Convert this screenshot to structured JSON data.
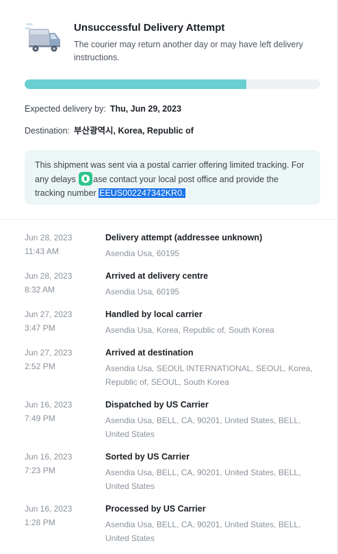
{
  "header": {
    "title": "Unsuccessful Delivery Attempt",
    "subtitle": "The courier may return another day or may have left delivery instructions.",
    "icon": "delivery-truck-icon"
  },
  "progress": {
    "percent": 75,
    "color": "#69cfd0"
  },
  "expected": {
    "label": "Expected delivery by:",
    "value": "Thu, Jun 29, 2023"
  },
  "destination": {
    "label": "Destination:",
    "value_korean": "부산광역시",
    "value_rest": ", Korea, Republic of"
  },
  "notice": {
    "text_before": "This shipment was sent via a postal carrier offering limited tracking. For any delays",
    "text_middle": "ase contact your local post office and provide the tracking number ",
    "tracking_number": "EEUS002247342KR0.",
    "badge_icon": "help-chat-icon"
  },
  "events": [
    {
      "date": "Jun 28, 2023",
      "time": "11:43 AM",
      "status": "Delivery attempt (addressee unknown)",
      "location": "Asendia Usa, 60195"
    },
    {
      "date": "Jun 28, 2023",
      "time": "8:32 AM",
      "status": "Arrived at delivery centre",
      "location": "Asendia Usa, 60195"
    },
    {
      "date": "Jun 27, 2023",
      "time": "3:47 PM",
      "status": "Handled by local carrier",
      "location": "Asendia Usa, Korea, Republic of, South Korea"
    },
    {
      "date": "Jun 27, 2023",
      "time": "2:52 PM",
      "status": "Arrived at destination",
      "location": "Asendia Usa, SEOUL INTERNATIONAL, SEOUL, Korea, Republic of, SEOUL, South Korea"
    },
    {
      "date": "Jun 16, 2023",
      "time": "7:49 PM",
      "status": "Dispatched by US Carrier",
      "location": "Asendia Usa, BELL, CA, 90201, United States, BELL, United States"
    },
    {
      "date": "Jun 16, 2023",
      "time": "7:23 PM",
      "status": "Sorted by US Carrier",
      "location": "Asendia Usa, BELL, CA, 90201, United States, BELL, United States"
    },
    {
      "date": "Jun 16, 2023",
      "time": "1:28 PM",
      "status": "Processed by US Carrier",
      "location": "Asendia Usa, BELL, CA, 90201, United States, BELL, United States"
    }
  ]
}
